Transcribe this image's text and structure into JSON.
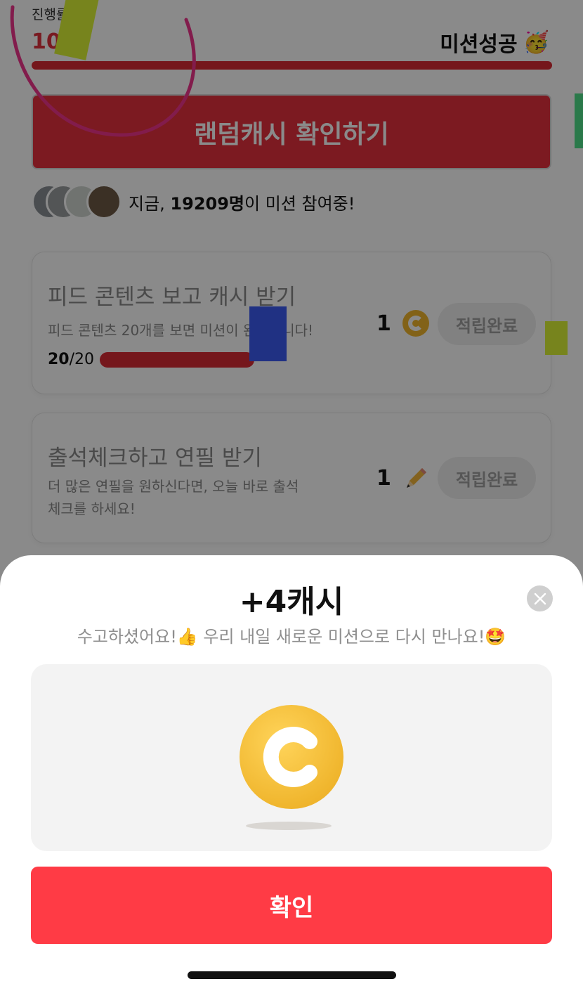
{
  "mission": {
    "progress_label": "진행률",
    "progress_value": "100",
    "success_label": "미션성공",
    "success_emoji": "🥳",
    "random_cash_button": "랜덤캐시 확인하기",
    "participants_prefix": "지금, ",
    "participants_count": "19209명",
    "participants_suffix": "이 미션 참여중!"
  },
  "cards": [
    {
      "title": "피드 콘텐츠 보고 캐시 받기",
      "description": "피드 콘텐츠 20개를 보면 미션이 완료됩니다!",
      "count_done": "20",
      "count_sep": "/",
      "count_total": "20",
      "reward_amount": "1",
      "reward_icon": "coin-icon",
      "status": "적립완료"
    },
    {
      "title": "출석체크하고 연필 받기",
      "description": "더 많은 연필을 원하신다면, 오늘 바로 출석체크를 하세요!",
      "reward_amount": "1",
      "reward_icon": "pencil-icon",
      "status": "적립완료"
    }
  ],
  "sheet": {
    "title": "+4캐시",
    "subtitle": "수고하셨어요!👍 우리 내일 새로운 미션으로 다시 만나요!🤩",
    "confirm_button": "확인",
    "close_icon": "close-icon"
  },
  "colors": {
    "accent": "#ff3b45",
    "progress": "#d82b35",
    "coin": "#f0b62e"
  }
}
